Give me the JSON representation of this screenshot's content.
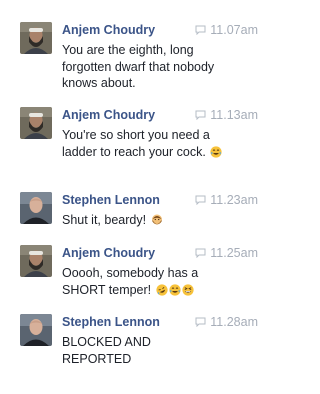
{
  "messages": [
    {
      "author": "Anjem Choudry",
      "time": "11.07am",
      "text": "You are the eighth, long forgotten dwarf that nobody knows about.",
      "avatar": "bearded-man-avatar"
    },
    {
      "author": "Anjem Choudry",
      "time": "11.13am",
      "text": "You're so short you need a ladder to reach your cock.",
      "emojis": [
        "tears-of-joy-emoji"
      ],
      "avatar": "bearded-man-avatar"
    },
    {
      "author": "Stephen Lennon",
      "time": "11.23am",
      "text": "Shut it, beardy!",
      "emojis": [
        "bearded-person-emoji"
      ],
      "avatar": "shaved-head-man-avatar"
    },
    {
      "author": "Anjem Choudry",
      "time": "11.25am",
      "text": "Ooooh, somebody has a SHORT temper!",
      "emojis": [
        "rolling-laughing-emoji",
        "tears-of-joy-emoji",
        "grinning-squinting-emoji"
      ],
      "avatar": "bearded-man-avatar"
    },
    {
      "author": "Stephen Lennon",
      "time": "11.28am",
      "text": "BLOCKED AND REPORTED",
      "avatar": "shaved-head-man-avatar"
    }
  ],
  "colors": {
    "author": "#3b5488",
    "time": "#a6adb8",
    "text": "#1d2129"
  }
}
